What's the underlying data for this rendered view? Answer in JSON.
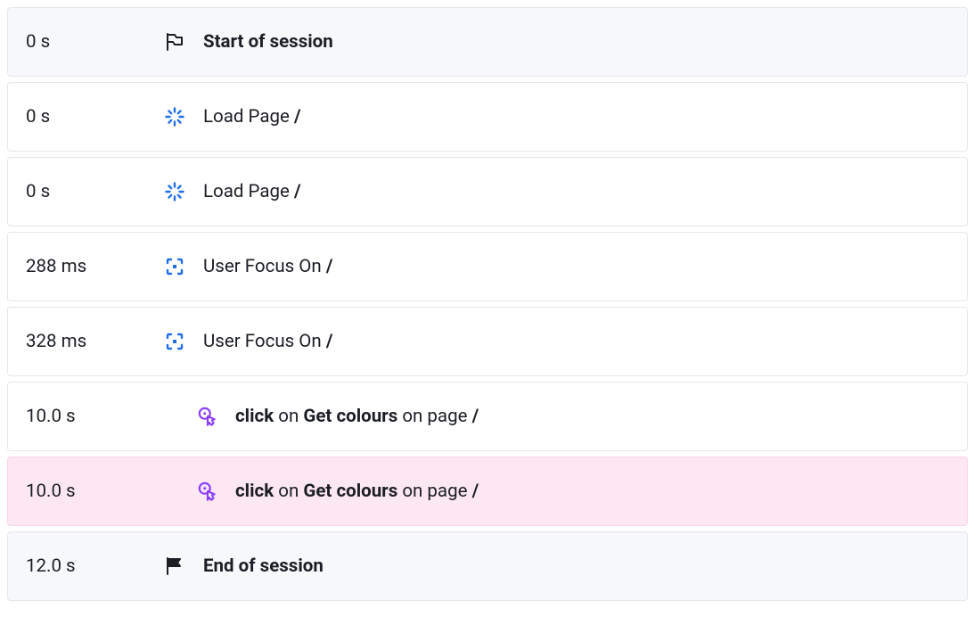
{
  "events": [
    {
      "time": "0 s",
      "kind": "session-start",
      "title": "Start of session",
      "highlight": false
    },
    {
      "time": "0 s",
      "kind": "load-page",
      "action": "Load Page",
      "path": "/",
      "highlight": false
    },
    {
      "time": "0 s",
      "kind": "load-page",
      "action": "Load Page",
      "path": "/",
      "highlight": false
    },
    {
      "time": "288 ms",
      "kind": "focus",
      "action": "User Focus On",
      "path": "/",
      "highlight": false
    },
    {
      "time": "328 ms",
      "kind": "focus",
      "action": "User Focus On",
      "path": "/",
      "highlight": false
    },
    {
      "time": "10.0 s",
      "kind": "click",
      "verb": "click",
      "conn1": "on",
      "target": "Get colours",
      "conn2": "on page",
      "path": "/",
      "highlight": false
    },
    {
      "time": "10.0 s",
      "kind": "click",
      "verb": "click",
      "conn1": "on",
      "target": "Get colours",
      "conn2": "on page",
      "path": "/",
      "highlight": true
    },
    {
      "time": "12.0 s",
      "kind": "session-end",
      "title": "End of session",
      "highlight": false
    }
  ]
}
